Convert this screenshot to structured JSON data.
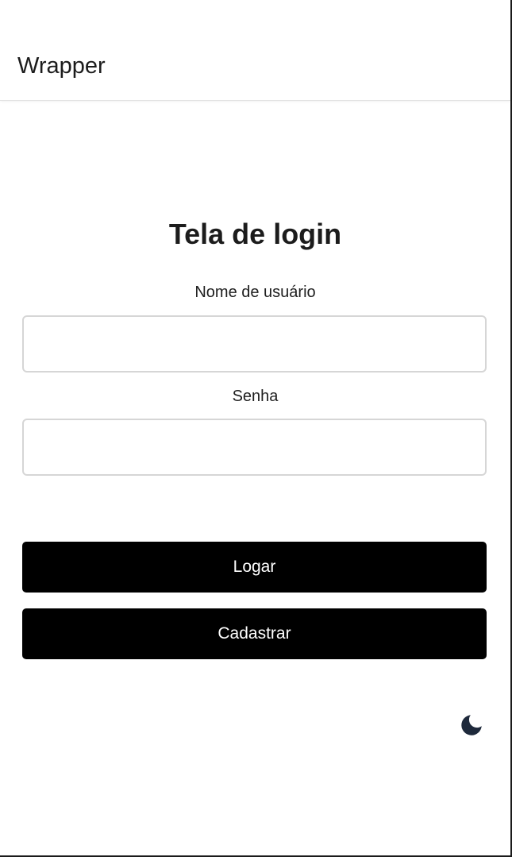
{
  "app_bar": {
    "title": "Wrapper"
  },
  "login": {
    "heading": "Tela de login",
    "username_label": "Nome de usuário",
    "username_value": "",
    "username_placeholder": "",
    "password_label": "Senha",
    "password_value": "",
    "password_placeholder": "",
    "login_button": "Logar",
    "register_button": "Cadastrar"
  },
  "theme_toggle": {
    "icon": "moon-icon",
    "color": "#1e293b"
  }
}
